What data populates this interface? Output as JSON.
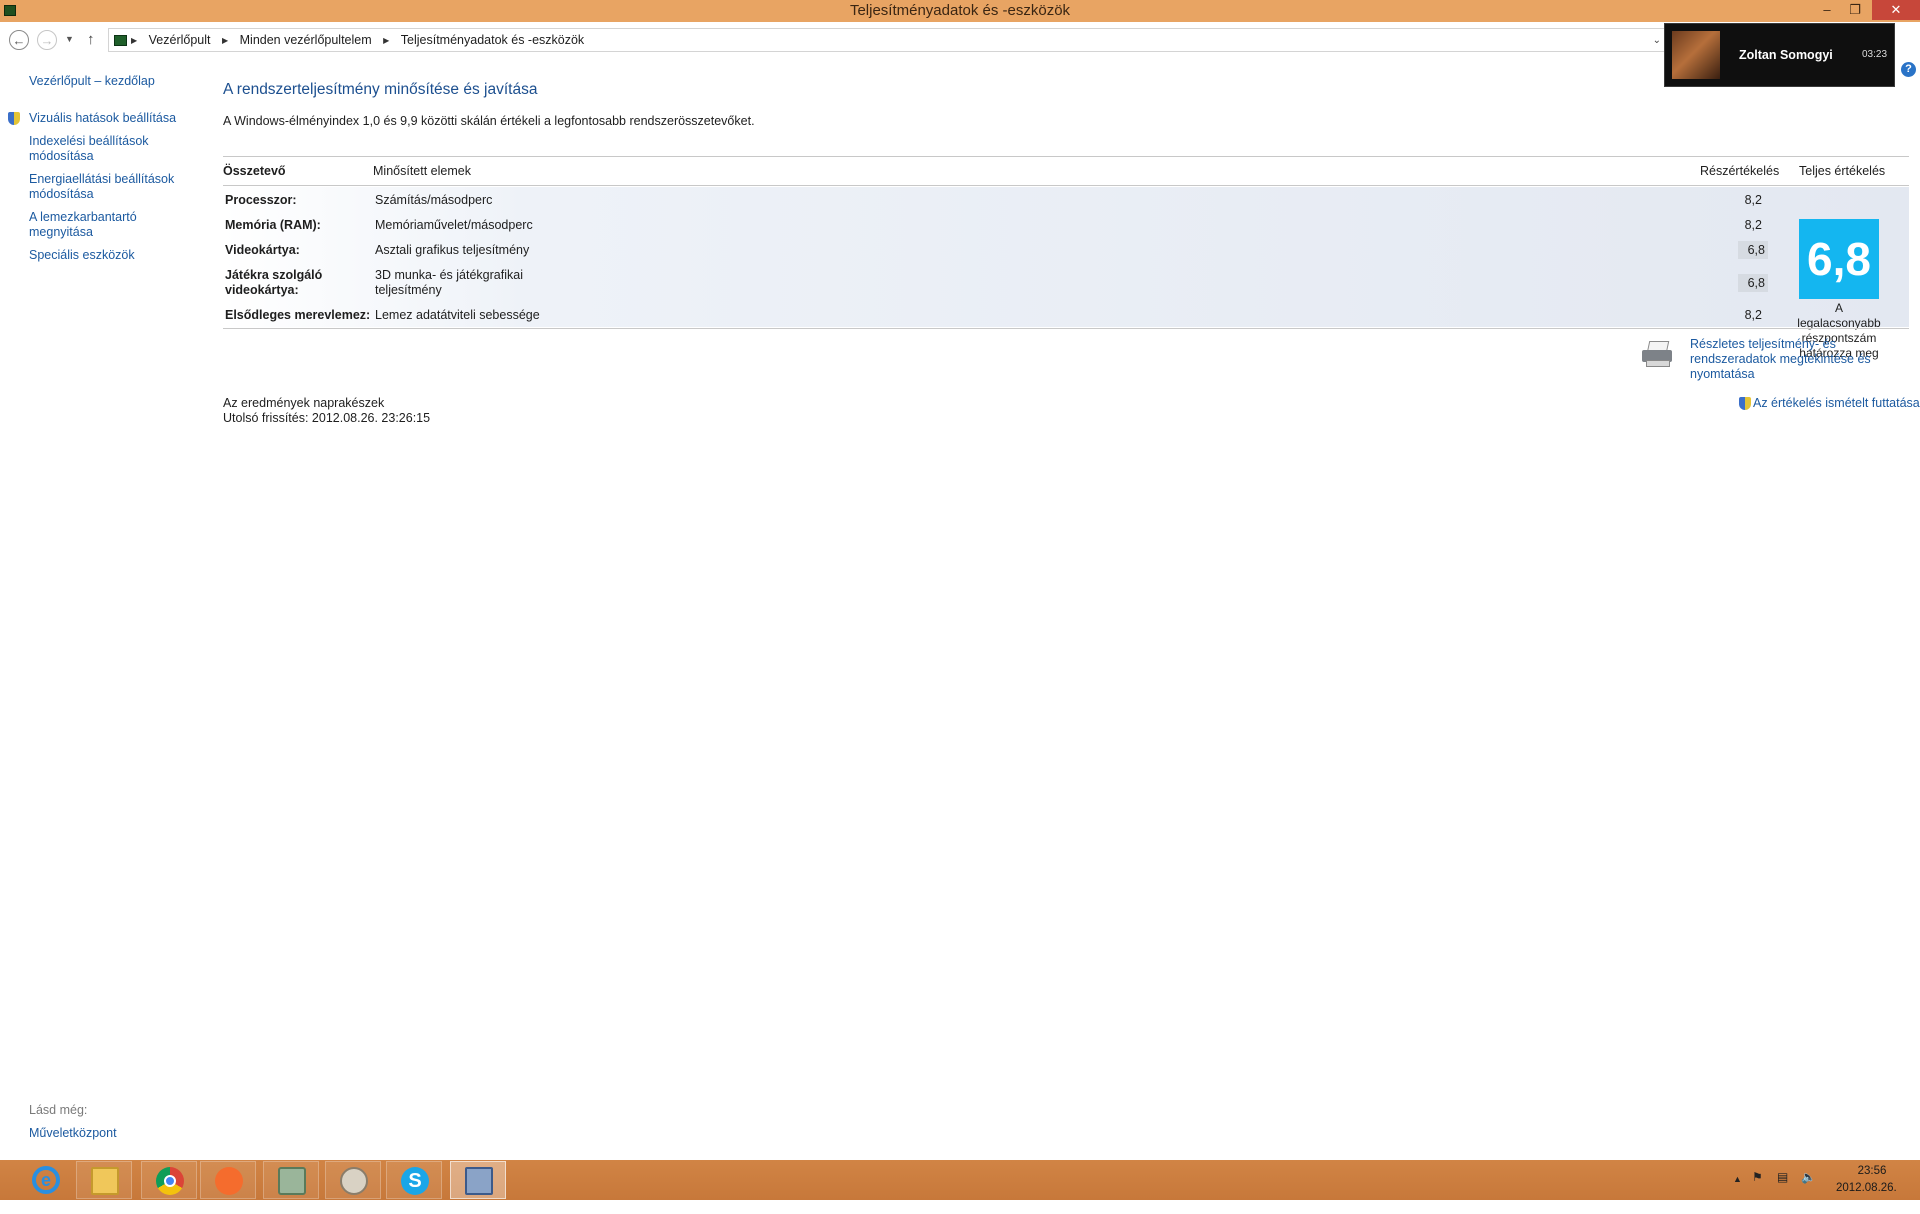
{
  "window": {
    "title": "Teljesítményadatok és -eszközök",
    "minimize_glyph": "–",
    "maximize_glyph": "❐",
    "close_glyph": "✕"
  },
  "address_bar": {
    "breadcrumbs": [
      "Vezérlőpult",
      "Minden vezérlőpultelem",
      "Teljesítményadatok és -eszközök"
    ]
  },
  "notification": {
    "name": "Zoltan Somogyi",
    "time": "03:23"
  },
  "help_glyph": "?",
  "sidebar": {
    "home": "Vezérlőpult – kezdőlap",
    "items": [
      {
        "label": "Vizuális hatások beállítása",
        "icon": "shield-icon"
      },
      {
        "label": "Indexelési beállítások módosítása"
      },
      {
        "label": "Energiaellátási beállítások módosítása"
      },
      {
        "label": "A lemezkarbantartó megnyitása"
      },
      {
        "label": "Speciális eszközök"
      }
    ],
    "see_also_label": "Lásd még:",
    "see_also_link": "Műveletközpont"
  },
  "main": {
    "heading": "A rendszerteljesítmény minősítése és javítása",
    "description": "A Windows-élményindex 1,0 és 9,9 közötti skálán értékeli a legfontosabb rendszerösszetevőket.",
    "table": {
      "headers": {
        "component": "Összetevő",
        "items": "Minősített elemek",
        "subscore": "Részértékelés",
        "base": "Teljes értékelés"
      },
      "rows": [
        {
          "component": "Processzor:",
          "item": "Számítás/másodperc",
          "score": "8,2"
        },
        {
          "component": "Memória (RAM):",
          "item": "Memóriaművelet/másodperc",
          "score": "8,2"
        },
        {
          "component": "Videokártya:",
          "item": "Asztali grafikus teljesítmény",
          "score": "6,8"
        },
        {
          "component": "Játékra szolgáló videokártya:",
          "item": "3D munka- és játékgrafikai teljesítmény",
          "score": "6,8"
        },
        {
          "component": "Elsődleges merevlemez:",
          "item": "Lemez adatátviteli sebessége",
          "score": "8,2"
        }
      ],
      "base_score": "6,8",
      "base_note": "A legalacsonyabb részpontszám határozza meg"
    },
    "detail_link": "Részletes teljesítmény- és rendszeradatok megtekintése és nyomtatása",
    "status": "Az eredmények naprakészek",
    "last_update": "Utolsó frissítés: 2012.08.26. 23:26:15",
    "rerun_link": "Az értékelés ismételt futtatása"
  },
  "taskbar": {
    "apps": [
      "ie-icon",
      "file-explorer-icon",
      "chrome-icon",
      "origin-icon",
      "disk-icon",
      "paint-icon",
      "skype-icon",
      "performance-icon"
    ],
    "active_app": "performance-icon",
    "clock_time": "23:56",
    "clock_date": "2012.08.26."
  }
}
